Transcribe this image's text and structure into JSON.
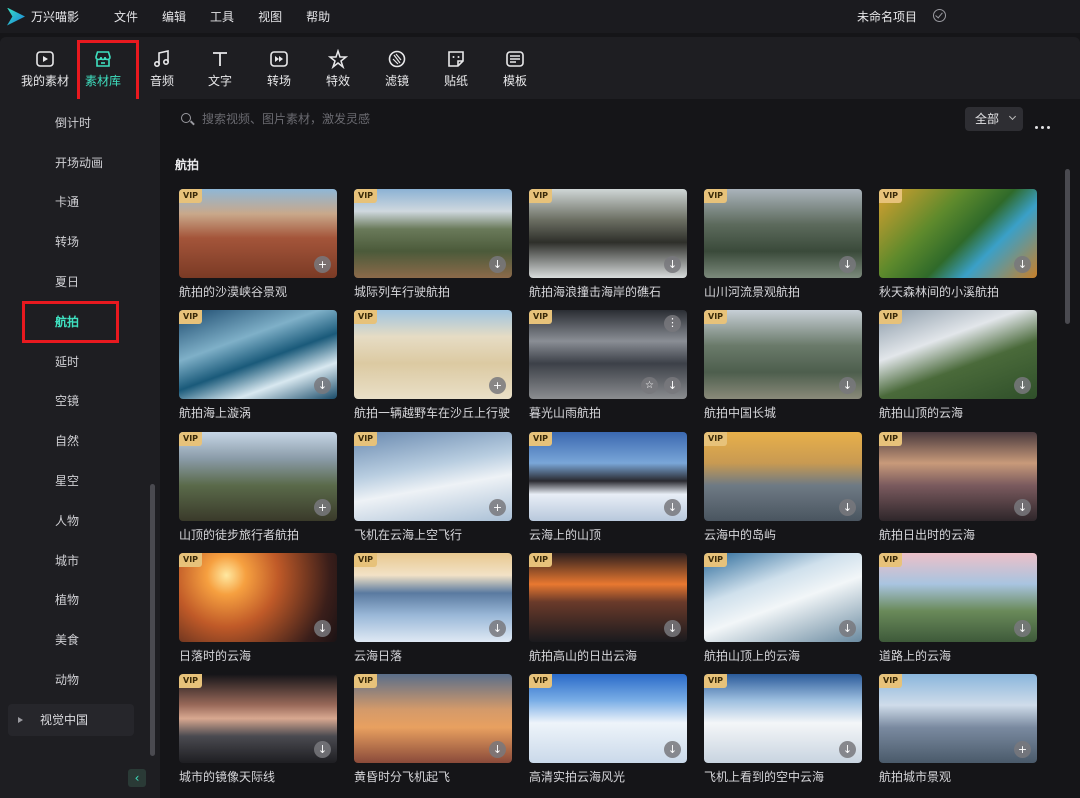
{
  "titlebar": {
    "app_name": "万兴喵影",
    "menu": [
      "文件",
      "编辑",
      "工具",
      "视图",
      "帮助"
    ],
    "project_name": "未命名项目"
  },
  "toolbar": {
    "tabs": [
      {
        "label": "我的素材",
        "icon": "folder-play-icon"
      },
      {
        "label": "素材库",
        "icon": "store-icon",
        "active": true
      },
      {
        "label": "音频",
        "icon": "music-note-icon"
      },
      {
        "label": "文字",
        "icon": "text-t-icon"
      },
      {
        "label": "转场",
        "icon": "transition-icon"
      },
      {
        "label": "特效",
        "icon": "effects-icon"
      },
      {
        "label": "滤镜",
        "icon": "filter-icon"
      },
      {
        "label": "贴纸",
        "icon": "sticker-icon"
      },
      {
        "label": "模板",
        "icon": "template-icon"
      }
    ]
  },
  "sidebar": {
    "items": [
      "倒计时",
      "开场动画",
      "卡通",
      "转场",
      "夏日",
      "航拍",
      "延时",
      "空镜",
      "自然",
      "星空",
      "人物",
      "城市",
      "植物",
      "美食",
      "动物"
    ],
    "active": "航拍",
    "group": "视觉中国"
  },
  "search": {
    "placeholder": "搜索视频、图片素材，激发灵感"
  },
  "filter": {
    "selected": "全部"
  },
  "section_title": "航拍",
  "vip_label": "VIP",
  "cards": [
    {
      "label": "航拍的沙漠峡谷景观",
      "action": "plus"
    },
    {
      "label": "城际列车行驶航拍",
      "action": "download"
    },
    {
      "label": "航拍海浪撞击海岸的礁石",
      "action": "download"
    },
    {
      "label": "山川河流景观航拍",
      "action": "download"
    },
    {
      "label": "秋天森林间的小溪航拍",
      "action": "download"
    },
    {
      "label": "航拍海上漩涡",
      "action": "download"
    },
    {
      "label": "航拍一辆越野车在沙丘上行驶",
      "action": "plus"
    },
    {
      "label": "暮光山雨航拍",
      "action": "download"
    },
    {
      "label": "航拍中国长城",
      "action": "download"
    },
    {
      "label": "航拍山顶的云海",
      "action": "download"
    },
    {
      "label": "山顶的徒步旅行者航拍",
      "action": "plus"
    },
    {
      "label": "飞机在云海上空飞行",
      "action": "plus"
    },
    {
      "label": "云海上的山顶",
      "action": "download"
    },
    {
      "label": "云海中的岛屿",
      "action": "download"
    },
    {
      "label": "航拍日出时的云海",
      "action": "download"
    },
    {
      "label": "日落时的云海",
      "action": "download"
    },
    {
      "label": "云海日落",
      "action": "download"
    },
    {
      "label": "航拍高山的日出云海",
      "action": "download"
    },
    {
      "label": "航拍山顶上的云海",
      "action": "download"
    },
    {
      "label": "道路上的云海",
      "action": "download"
    },
    {
      "label": "城市的镜像天际线",
      "action": "download"
    },
    {
      "label": "黄昏时分飞机起飞",
      "action": "download"
    },
    {
      "label": "高清实拍云海风光",
      "action": "download"
    },
    {
      "label": "飞机上看到的空中云海",
      "action": "download"
    },
    {
      "label": "航拍城市景观",
      "action": "plus"
    }
  ],
  "icons": {
    "download": "↓",
    "plus": "+",
    "star": "☆",
    "kebab": "⋮",
    "collapse": "‹"
  }
}
